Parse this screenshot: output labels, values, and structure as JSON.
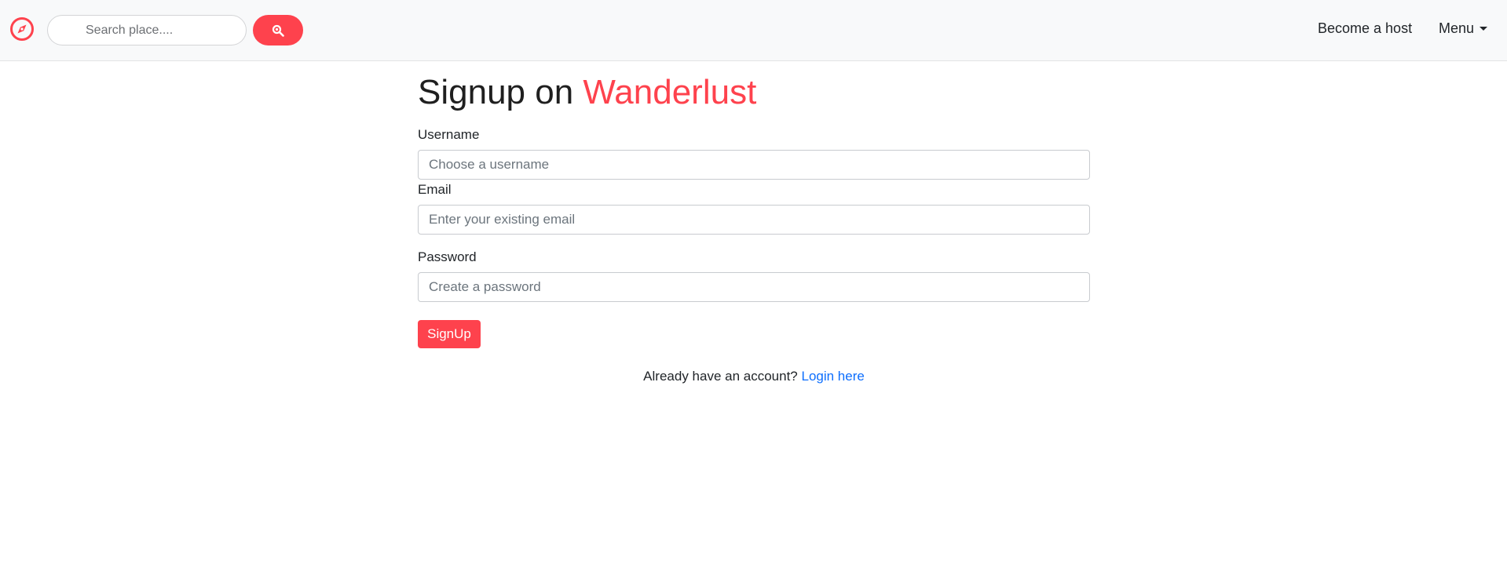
{
  "navbar": {
    "logo_icon": "compass-icon",
    "search": {
      "placeholder": "Search place....",
      "value": "",
      "button_icon": "search-icon"
    },
    "become_host": "Become a host",
    "menu": "Menu"
  },
  "form": {
    "title_prefix": "Signup on ",
    "title_brand": "Wanderlust",
    "username": {
      "label": "Username",
      "placeholder": "Choose a username",
      "value": ""
    },
    "email": {
      "label": "Email",
      "placeholder": "Enter your existing email",
      "value": ""
    },
    "password": {
      "label": "Password",
      "placeholder": "Create a password",
      "value": ""
    },
    "submit_label": "SignUp",
    "login_prompt": "Already have an account? ",
    "login_link": "Login here"
  },
  "colors": {
    "accent": "#fe424d",
    "link": "#0d6efd",
    "navbar_bg": "#f8f9fa"
  }
}
